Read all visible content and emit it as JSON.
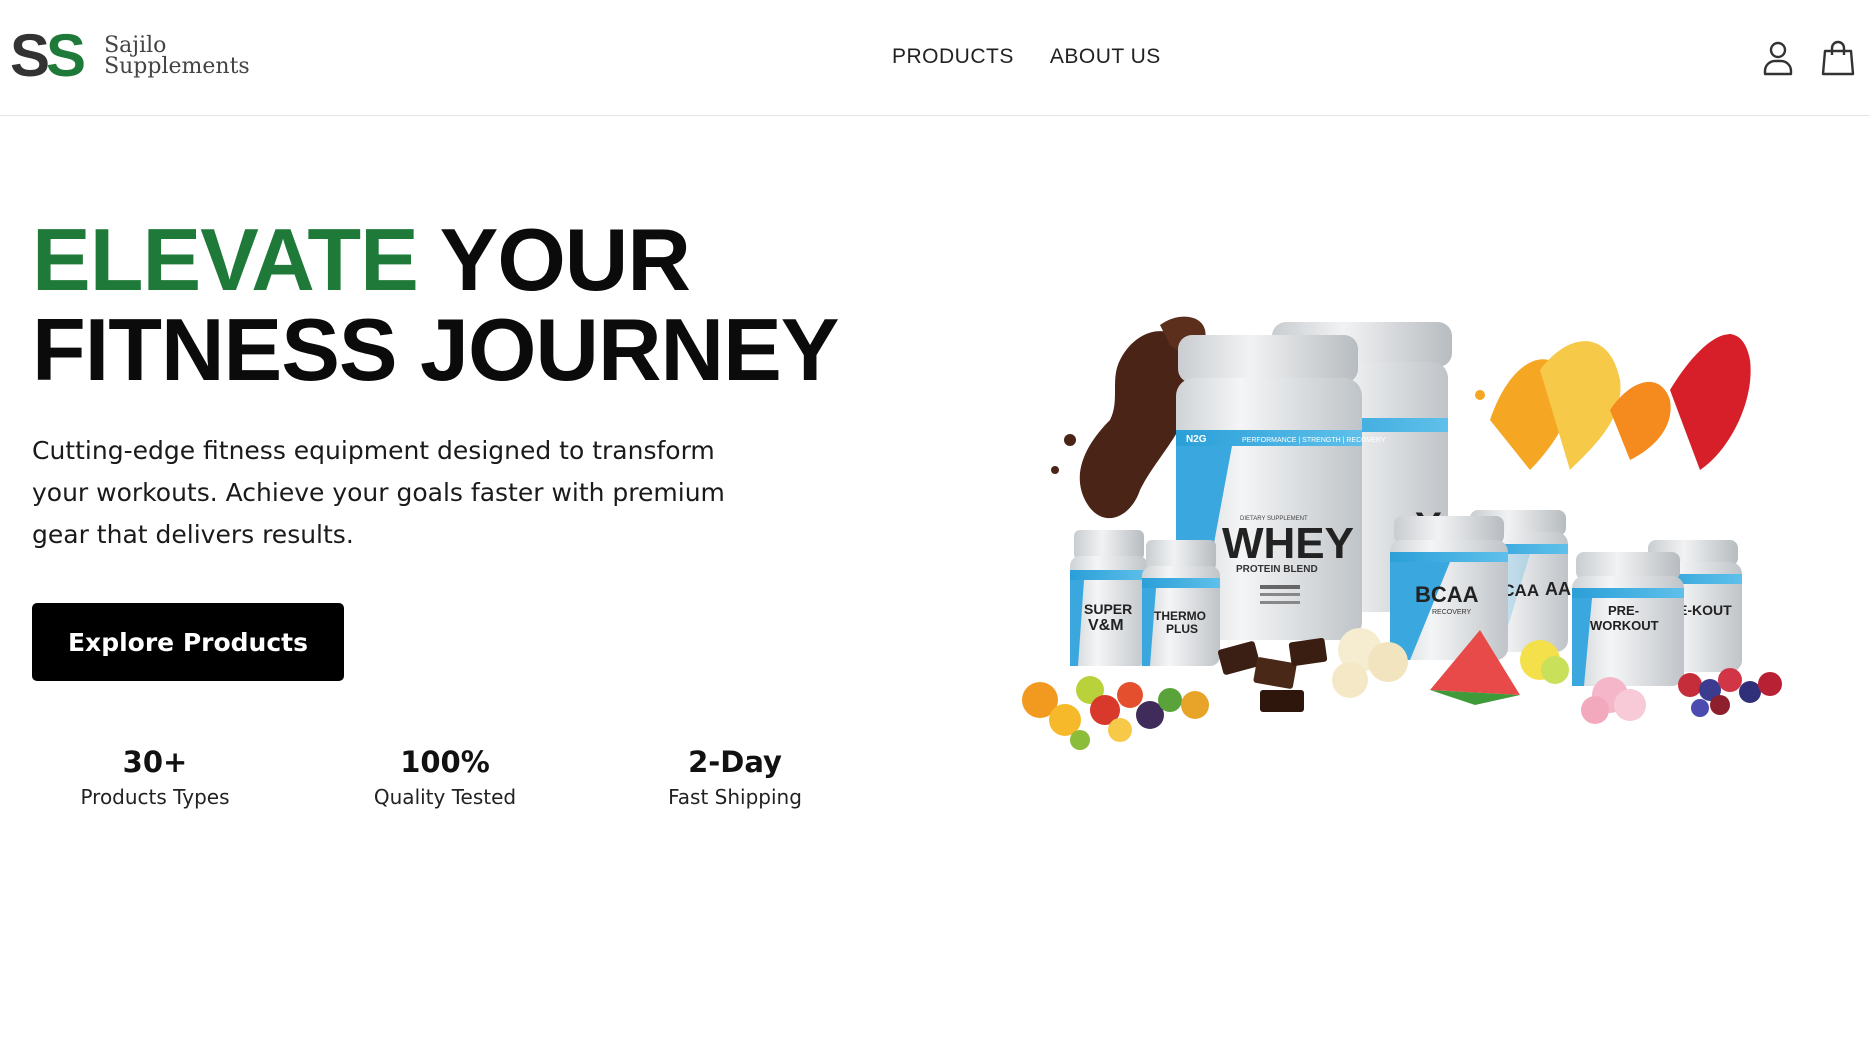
{
  "brand": {
    "mark_left": "S",
    "mark_right": "S",
    "line1": "Sajilo",
    "line2": "Supplements",
    "colors": {
      "dark": "#333333",
      "green": "#1f7a3a"
    }
  },
  "nav": {
    "items": [
      {
        "label": "PRODUCTS"
      },
      {
        "label": "ABOUT US"
      }
    ]
  },
  "header_icons": {
    "account": "user-icon",
    "cart": "shopping-bag-icon"
  },
  "hero": {
    "title_accent": "ELEVATE",
    "title_rest_line1": "YOUR",
    "title_line2": "FITNESS JOURNEY",
    "description": "Cutting-edge fitness equipment designed to transform your workouts. Achieve your goals faster with premium gear that delivers results.",
    "cta_label": "Explore Products",
    "accent_color": "#1f7a3a"
  },
  "stats": [
    {
      "value": "30+",
      "label": "Products Types"
    },
    {
      "value": "100%",
      "label": "Quality Tested"
    },
    {
      "value": "2-Day",
      "label": "Fast Shipping"
    }
  ],
  "product_image": {
    "labels": {
      "big_tub_brand": "N2G",
      "big_tub_band": "PERFORMANCE | STRENGTH | RECOVERY",
      "big_tub_small": "DIETARY SUPPLEMENT",
      "big_tub_name": "WHEY",
      "big_tub_sub": "PROTEIN BLEND",
      "back_tub_name": "Y",
      "bottle1": "SUPER V&M",
      "bottle2": "THERMO PLUS",
      "tub_bcaa": "BCAA",
      "tub_bcaa_sub": "RECOVERY",
      "tub_aa": "AA",
      "tub_pre": "PRE-WORKOUT",
      "tub_back_pre": "E-KOUT"
    }
  }
}
